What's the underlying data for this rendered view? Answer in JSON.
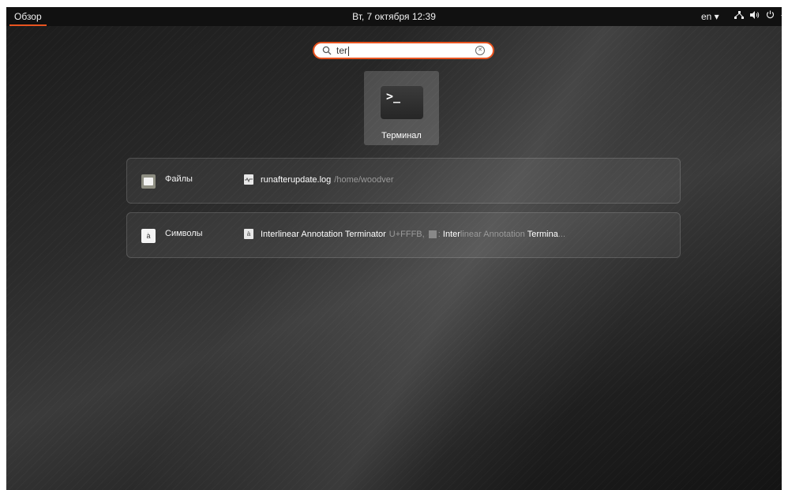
{
  "topbar": {
    "activities": "Обзор",
    "clock": "Вт, 7 октября  12:39",
    "language": "en ▾",
    "tray_icons": [
      "network-icon",
      "volume-icon",
      "power-icon",
      "chevron-down-icon"
    ]
  },
  "search": {
    "value": "ter",
    "icon": "search-icon",
    "clear_icon": "clear-icon"
  },
  "apps": [
    {
      "label": "Терминал",
      "icon": "terminal-icon",
      "glyph": ">_"
    }
  ],
  "providers": {
    "files": {
      "name": "Файлы",
      "icon": "folder-icon",
      "result": {
        "title": "runafterupdate.log",
        "path": "/home/woodver"
      }
    },
    "characters": {
      "name": "Символы",
      "icon": "characters-icon",
      "icon_glyph": "à",
      "result": {
        "title": "Interlinear Annotation Terminator",
        "code": "U+FFFB,",
        "desc_part1": ": ",
        "desc_hl1": "Inter",
        "desc_part2": "linear Annotation ",
        "desc_hl2": "Termina",
        "desc_ellipsis": "..."
      }
    }
  },
  "colors": {
    "accent": "#e95420",
    "topbar": "#111111"
  }
}
